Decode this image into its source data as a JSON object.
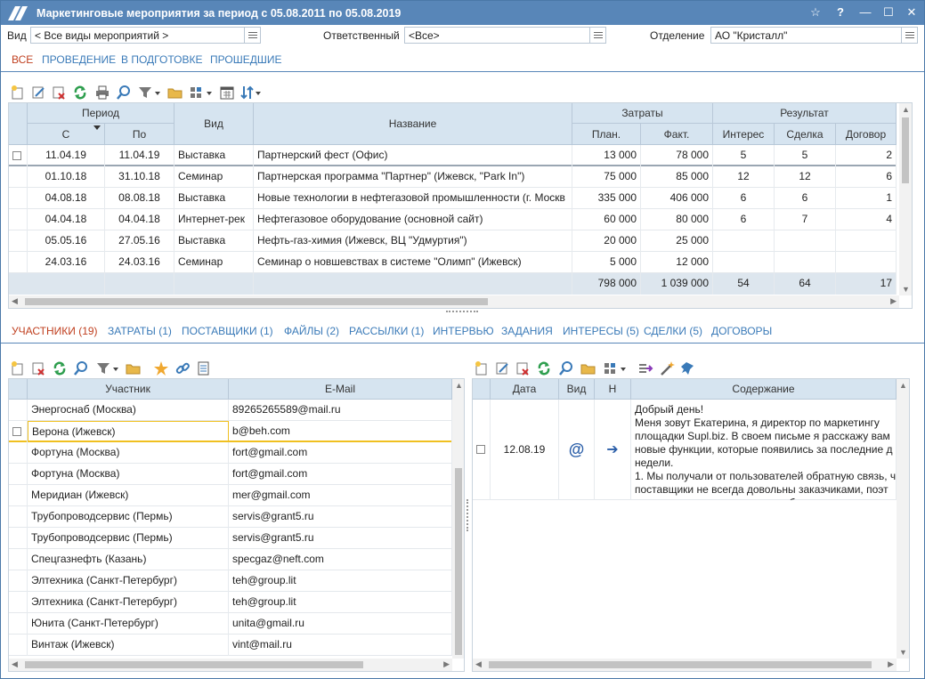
{
  "window": {
    "title": "Маркетинговые мероприятия за период с 05.08.2011 по 05.08.2019",
    "controls": [
      "☆",
      "?",
      "—",
      "☐",
      "✕"
    ]
  },
  "filters": {
    "vid_label": "Вид",
    "vid_value": "< Все виды мероприятий >",
    "resp_label": "Ответственный",
    "resp_value": "<Все>",
    "dept_label": "Отделение",
    "dept_value": "АО \"Кристалл\""
  },
  "top_tabs": [
    "ВСЕ",
    "ПРОВЕДЕНИЕ",
    "В ПОДГОТОВКЕ",
    "ПРОШЕДШИЕ"
  ],
  "events": {
    "header": {
      "period": "Период",
      "from": "С",
      "to": "По",
      "type": "Вид",
      "name": "Название",
      "costs": "Затраты",
      "plan": "План.",
      "fact": "Факт.",
      "result": "Результат",
      "interest": "Интерес",
      "deal": "Сделка",
      "contract": "Договор"
    },
    "rows": [
      {
        "from": "11.04.19",
        "to": "11.04.19",
        "type": "Выставка",
        "name": "Партнерский фест (Офис)",
        "plan": "13 000",
        "fact": "78 000",
        "interest": "5",
        "deal": "5",
        "contract": "2"
      },
      {
        "from": "01.10.18",
        "to": "31.10.18",
        "type": "Семинар",
        "name": "Партнерская программа \"Партнер\" (Ижевск, \"Park In\")",
        "plan": "75 000",
        "fact": "85 000",
        "interest": "12",
        "deal": "12",
        "contract": "6"
      },
      {
        "from": "04.08.18",
        "to": "08.08.18",
        "type": "Выставка",
        "name": "Новые технологии в нефтегазовой промышленности (г. Москв",
        "plan": "335 000",
        "fact": "406 000",
        "interest": "6",
        "deal": "6",
        "contract": "1"
      },
      {
        "from": "04.04.18",
        "to": "04.04.18",
        "type": "Интернет-рек",
        "name": "Нефтегазовое оборудование (основной сайт)",
        "plan": "60 000",
        "fact": "80 000",
        "interest": "6",
        "deal": "7",
        "contract": "4"
      },
      {
        "from": "05.05.16",
        "to": "27.05.16",
        "type": "Выставка",
        "name": "Нефть-газ-химия (Ижевск, ВЦ \"Удмуртия\")",
        "plan": "20 000",
        "fact": "25 000",
        "interest": "",
        "deal": "",
        "contract": ""
      },
      {
        "from": "24.03.16",
        "to": "24.03.16",
        "type": "Семинар",
        "name": "Семинар о новшевствах в системе \"Олимп\" (Ижевск)",
        "plan": "5 000",
        "fact": "12 000",
        "interest": "",
        "deal": "",
        "contract": ""
      }
    ],
    "totals": {
      "plan": "798 000",
      "fact": "1 039 000",
      "interest": "54",
      "deal": "64",
      "contract": "17"
    }
  },
  "bottom_tabs": [
    "УЧАСТНИКИ (19)",
    "ЗАТРАТЫ (1)",
    "ПОСТАВЩИКИ (1)",
    "ФАЙЛЫ (2)",
    "РАССЫЛКИ (1)",
    "ИНТЕРВЬЮ",
    "ЗАДАНИЯ",
    "ИНТЕРЕСЫ (5)",
    "СДЕЛКИ (5)",
    "ДОГОВОРЫ"
  ],
  "participants": {
    "header": {
      "name": "Участник",
      "email": "E-Mail"
    },
    "rows": [
      {
        "name": "Энергоснаб (Москва)",
        "email": "89265265589@mail.ru"
      },
      {
        "name": "Верона (Ижевск)",
        "email": "b@beh.com"
      },
      {
        "name": "Фортуна (Москва)",
        "email": "fort@gmail.com"
      },
      {
        "name": "Фортуна (Москва)",
        "email": "fort@gmail.com"
      },
      {
        "name": "Меридиан (Ижевск)",
        "email": "mer@gmail.com"
      },
      {
        "name": "Трубопроводсервис (Пермь)",
        "email": "servis@grant5.ru"
      },
      {
        "name": "Трубопроводсервис (Пермь)",
        "email": "servis@grant5.ru"
      },
      {
        "name": "Спецгазнефть (Казань)",
        "email": "specgaz@neft.com"
      },
      {
        "name": "Элтехника (Санкт-Петербург)",
        "email": "teh@group.lit"
      },
      {
        "name": "Элтехника (Санкт-Петербург)",
        "email": "teh@group.lit"
      },
      {
        "name": "Юнита (Санкт-Петербург)",
        "email": "unita@gmail.ru"
      },
      {
        "name": "Винтаж (Ижевск)",
        "email": "vint@mail.ru"
      }
    ]
  },
  "messages": {
    "header": {
      "date": "Дата",
      "type": "Вид",
      "dir": "Н",
      "content": "Содержание"
    },
    "rows": [
      {
        "date": "12.08.19",
        "type_glyph": "@",
        "dir_glyph": "➔",
        "lines": [
          "Добрый день!",
          "Меня зовут Екатерина, я директор по маркетингу",
          "площадки Supl.biz. В своем письме я расскажу вам",
          "новые функции, которые появились за последние д",
          "недели.",
          "1. Мы получали от пользователей обратную связь, ч",
          "поставщики не всегда довольны заказчиками, поэт",
          "решили усовершенствовать работу над предложен"
        ]
      }
    ]
  },
  "colors": {
    "accent": "#5886b8",
    "header_bg": "#d6e4f0",
    "active_tab": "#c04020",
    "link_tab": "#3a7ab8",
    "selection": "#f0c020"
  }
}
